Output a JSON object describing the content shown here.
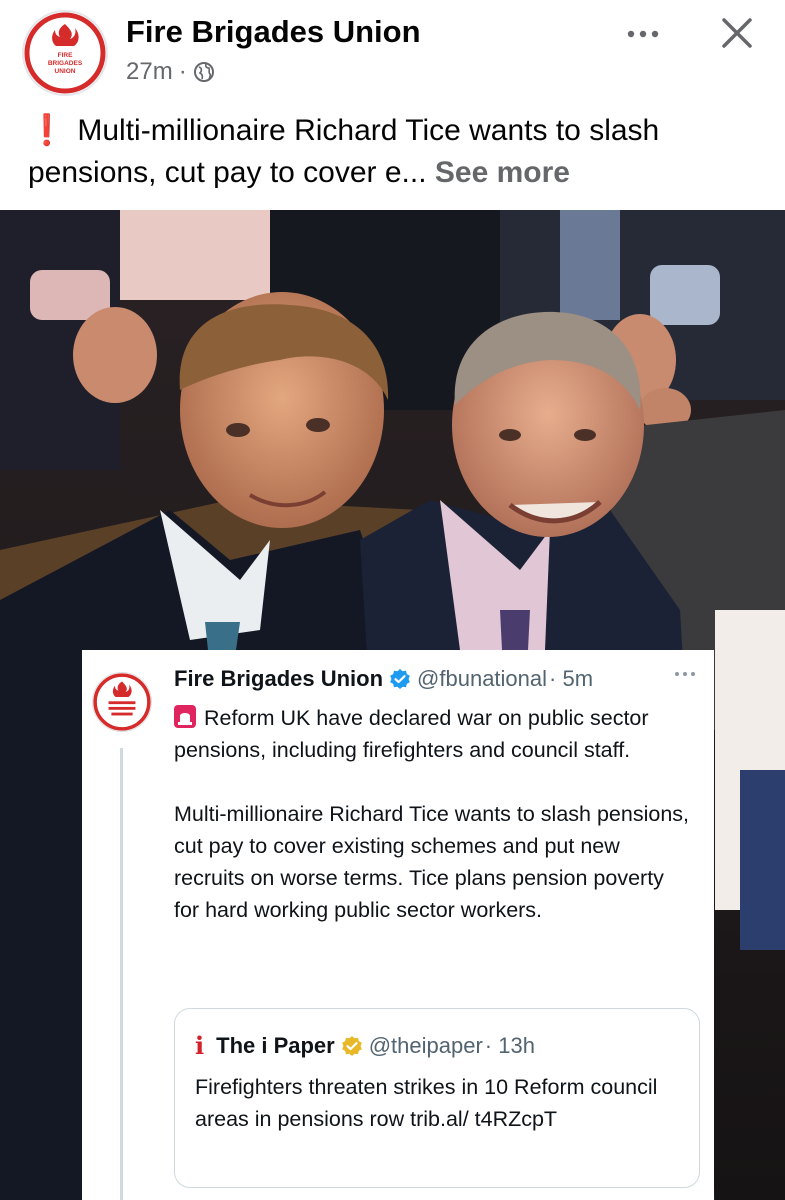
{
  "post": {
    "page_name": "Fire Brigades Union",
    "time_ago": "27m",
    "separator": "·",
    "caption": "Multi-millionaire Richard Tice wants to slash pensions, cut pay to cover e...",
    "see_more": "See more",
    "logo_text": [
      "FIRE",
      "BRIGADES",
      "UNION"
    ]
  },
  "tweet": {
    "name": "Fire Brigades Union",
    "handle": "@fbunational",
    "time": "· 5m",
    "paragraph1": "Reform UK have declared war on public sector pensions, including firefighters and council staff.",
    "paragraph2": "Multi-millionaire Richard Tice wants to slash pensions, cut pay to cover existing schemes and put new recruits on worse terms. Tice plans pension poverty for hard working public sector workers."
  },
  "quoted_tweet": {
    "logo": "i",
    "name": "The i Paper",
    "handle": "@theipaper",
    "time": "· 13h",
    "text": "Firefighters threaten strikes in 10 Reform council areas in pensions row trib.al/ t4RZcpT"
  },
  "icons": {
    "globe": "globe-icon",
    "more": "more-options-icon",
    "close": "close-icon",
    "verified": "verified-badge-icon",
    "siren": "siren-emoji-icon"
  },
  "colors": {
    "fbu_red": "#d52b2b",
    "verified_blue": "#1d9bf0",
    "verified_gold": "#e8b829",
    "exclamation_red": "#e41e3f"
  }
}
